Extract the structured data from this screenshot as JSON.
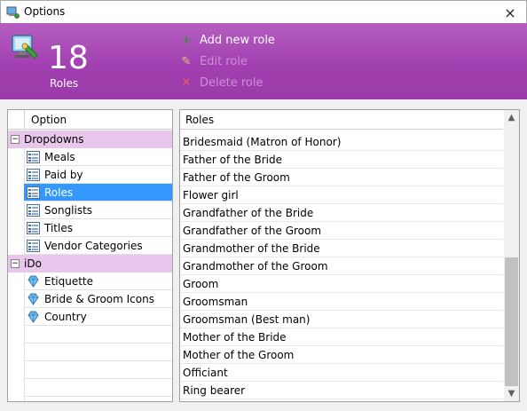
{
  "window": {
    "title": "Options",
    "close_icon": "×"
  },
  "header": {
    "count": "18",
    "count_label": "Roles",
    "actions": [
      {
        "label": "Add new role",
        "icon": "plus-icon",
        "glyph": "+",
        "enabled": true
      },
      {
        "label": "Edit role",
        "icon": "pencil-icon",
        "glyph": "✎",
        "enabled": false
      },
      {
        "label": "Delete role",
        "icon": "delete-x-icon",
        "glyph": "✕",
        "enabled": false
      }
    ]
  },
  "left_panel": {
    "header": "Option",
    "groups": [
      {
        "label": "Dropdowns",
        "expander": "⊟",
        "items": [
          "Meals",
          "Paid by",
          "Roles",
          "Songlists",
          "Titles",
          "Vendor Categories"
        ]
      },
      {
        "label": "iDo",
        "expander": "⊟",
        "items": [
          "Etiquette",
          "Bride & Groom Icons",
          "Country"
        ]
      }
    ],
    "selected": "Roles"
  },
  "right_panel": {
    "header": "Roles",
    "rows": [
      "Bridesmaid (Matron of Honor)",
      "Father of the Bride",
      "Father of the Groom",
      "Flower girl",
      "Grandfather of the Bride",
      "Grandfather of the Groom",
      "Grandmother of the Bride",
      "Grandmother of the Groom",
      "Groom",
      "Groomsman",
      "Groomsman (Best man)",
      "Mother of the Bride",
      "Mother of the Groom",
      "Officiant",
      "Ring bearer"
    ],
    "scroll_up": "▲",
    "scroll_down": "▼"
  },
  "colors": {
    "header_purple": "#a23fb1",
    "group_bg": "#e9c7ec",
    "selection": "#3399ff",
    "add_icon": "#3c8c3c",
    "disabled_text": "#cc90d4"
  }
}
